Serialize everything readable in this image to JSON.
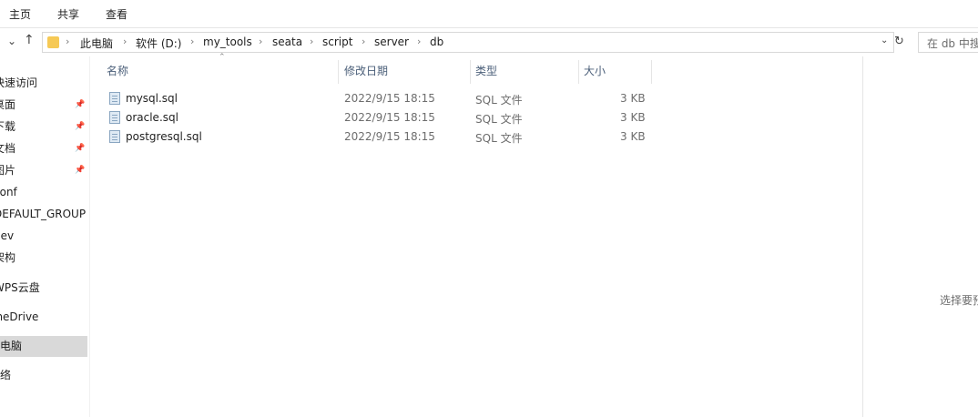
{
  "ribbon": {
    "tabs": [
      "主页",
      "共享",
      "查看"
    ]
  },
  "address": {
    "back_icon": "chevron-down",
    "up_icon": "up-arrow",
    "segments": [
      "此电脑",
      "软件 (D:)",
      "my_tools",
      "seata",
      "script",
      "server",
      "db"
    ],
    "refresh_icon": "refresh",
    "search_placeholder": "在 db 中搜"
  },
  "nav": {
    "items": [
      {
        "label": "快速访问",
        "pinned": false,
        "selected": false
      },
      {
        "label": "桌面",
        "pinned": true,
        "selected": false
      },
      {
        "label": "下载",
        "pinned": true,
        "selected": false
      },
      {
        "label": "文档",
        "pinned": true,
        "selected": false
      },
      {
        "label": "图片",
        "pinned": true,
        "selected": false
      },
      {
        "label": "conf",
        "pinned": false,
        "selected": false
      },
      {
        "label": "DEFAULT_GROUP",
        "pinned": false,
        "selected": false
      },
      {
        "label": "dev",
        "pinned": false,
        "selected": false
      },
      {
        "label": "架构",
        "pinned": false,
        "selected": false
      },
      {
        "label": "WPS云盘",
        "pinned": false,
        "selected": false
      },
      {
        "label": "OneDrive",
        "pinned": false,
        "selected": false
      },
      {
        "label": "此电脑",
        "pinned": false,
        "selected": true
      },
      {
        "label": "网络",
        "pinned": false,
        "selected": false
      }
    ]
  },
  "columns": {
    "name": "名称",
    "modified": "修改日期",
    "type": "类型",
    "size": "大小"
  },
  "files": [
    {
      "name": "mysql.sql",
      "modified": "2022/9/15 18:15",
      "type": "SQL 文件",
      "size": "3 KB"
    },
    {
      "name": "oracle.sql",
      "modified": "2022/9/15 18:15",
      "type": "SQL 文件",
      "size": "3 KB"
    },
    {
      "name": "postgresql.sql",
      "modified": "2022/9/15 18:15",
      "type": "SQL 文件",
      "size": "3 KB"
    }
  ],
  "preview": {
    "text": "选择要预"
  }
}
